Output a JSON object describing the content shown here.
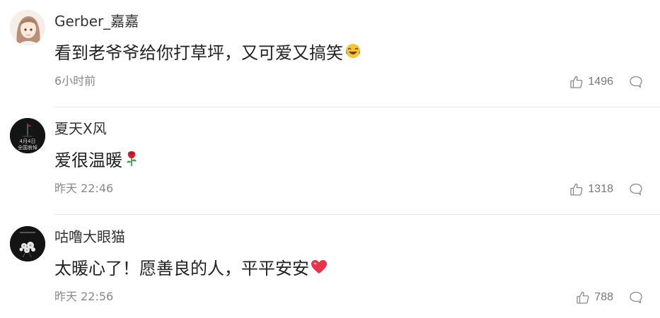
{
  "comments": [
    {
      "username": "Gerber_嘉嘉",
      "text": "看到老爷爷给你打草坪，又可爱又搞笑",
      "emoji": "laugh-cry-emoji",
      "time": "6小时前",
      "likes": "1496"
    },
    {
      "username": "夏天X风",
      "text": "爱很温暖",
      "emoji": "rose-emoji",
      "time": "昨天 22:46",
      "likes": "1318",
      "avatar_text": [
        "4月4日",
        "全国哀悼"
      ]
    },
    {
      "username": "咕噜大眼猫",
      "text": "太暖心了！愿善良的人，平平安安",
      "emoji": "red-heart-emoji",
      "time": "昨天 22:56",
      "likes": "788"
    }
  ],
  "colors": {
    "username": "#333333",
    "text": "#222222",
    "meta": "#888888",
    "divider": "#e6e6e6",
    "heart": "#e8344a"
  }
}
